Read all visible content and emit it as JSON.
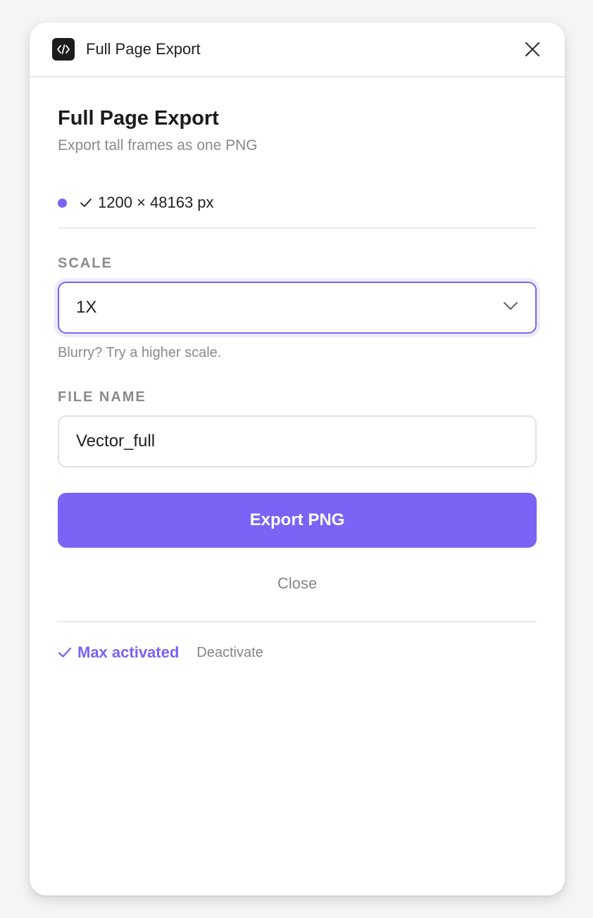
{
  "titlebar": {
    "icon": "code-icon",
    "title": "Full Page Export",
    "close_icon": "close-icon"
  },
  "header": {
    "title": "Full Page Export",
    "subtitle": "Export tall frames as one PNG"
  },
  "status": {
    "text": "1200 × 48163 px",
    "dot_color": "#7a63f5"
  },
  "scale": {
    "label": "SCALE",
    "selected": "1X",
    "hint": "Blurry? Try a higher scale."
  },
  "file_name": {
    "label": "FILE NAME",
    "value": "Vector_full"
  },
  "actions": {
    "export_label": "Export PNG",
    "close_label": "Close"
  },
  "license": {
    "status": "Max activated",
    "deactivate_label": "Deactivate"
  },
  "colors": {
    "accent": "#7a63f5",
    "muted_text": "#8a8a8a",
    "border": "#e1e1e1"
  }
}
